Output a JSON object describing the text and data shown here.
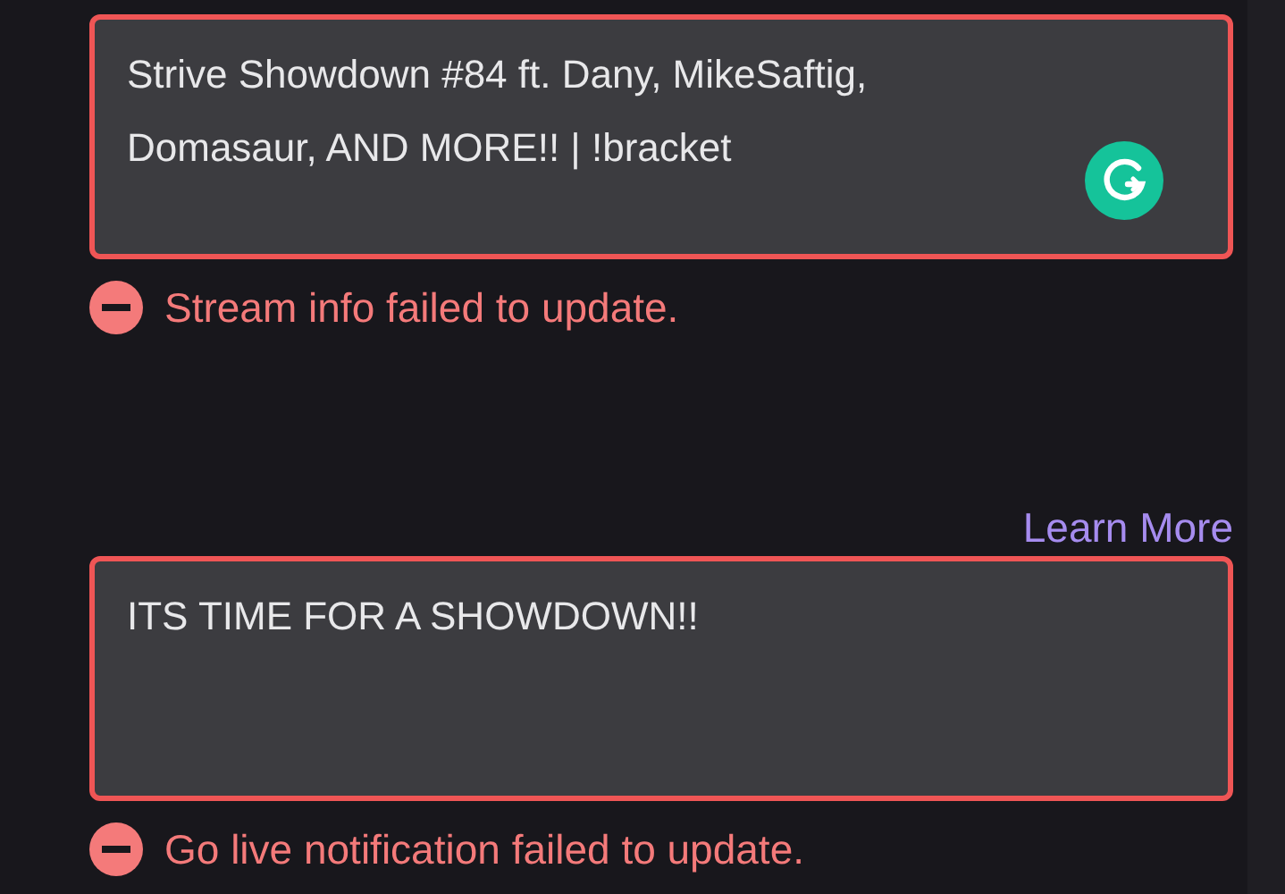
{
  "fields": [
    {
      "value": "Strive Showdown #84 ft. Dany, MikeSaftig, Domasaur, AND MORE!! | !bracket",
      "invalid": true,
      "error": "Stream info failed to update.",
      "assistant_badge": true
    },
    {
      "value": "ITS TIME FOR A SHOWDOWN!!",
      "invalid": true,
      "link": "Learn More",
      "error": "Go live notification failed to update.",
      "assistant_badge": false
    }
  ]
}
